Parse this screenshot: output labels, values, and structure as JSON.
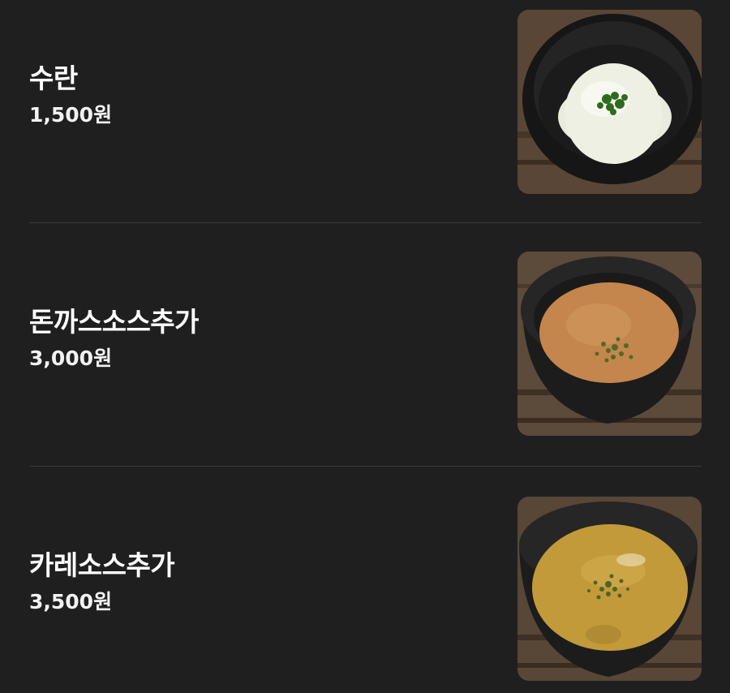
{
  "menu": {
    "items": [
      {
        "name": "수란",
        "price": "1,500원",
        "photo_icon": "poached-egg-photo",
        "sauce_color": "#f4f3e8"
      },
      {
        "name": "돈까스소스추가",
        "price": "3,000원",
        "photo_icon": "tonkatsu-sauce-photo",
        "sauce_color": "#c98a4e"
      },
      {
        "name": "카레소스추가",
        "price": "3,500원",
        "photo_icon": "curry-sauce-photo",
        "sauce_color": "#c9a03c"
      }
    ]
  },
  "colors": {
    "background": "#1f1f20",
    "divider": "#3a3a3c",
    "text": "#ffffff"
  }
}
